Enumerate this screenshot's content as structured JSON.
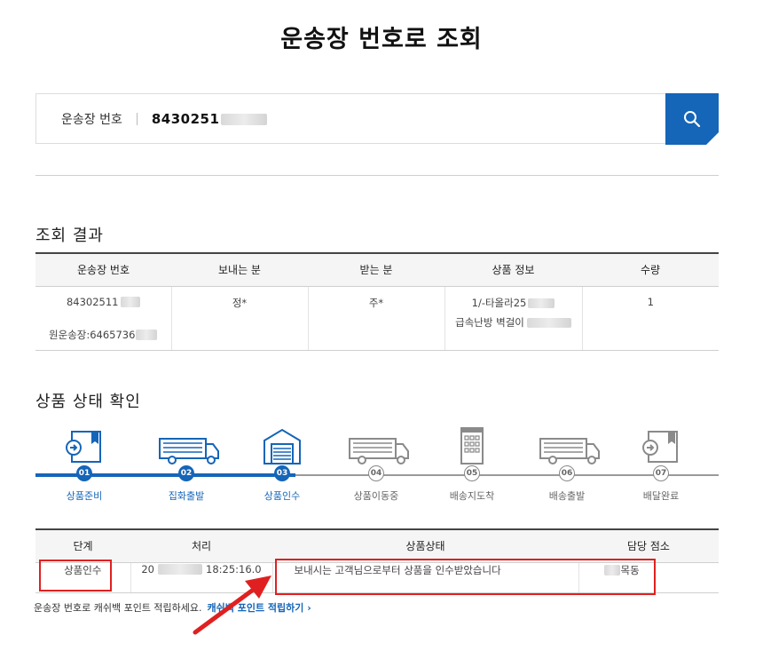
{
  "page": {
    "title": "운송장 번호로 조회"
  },
  "search": {
    "label": "운송장 번호",
    "value_prefix": "8430251",
    "button_icon": "search-icon"
  },
  "result": {
    "section_title": "조회 결과",
    "headers": [
      "운송장 번호",
      "보내는 분",
      "받는 분",
      "상품 정보",
      "수량"
    ],
    "row": {
      "waybill": "84302511",
      "origin_waybill": "원운송장:6465736",
      "sender": "정*",
      "receiver": "주*",
      "product_line1": "1/-타올라25",
      "product_line2": "급속난방 벽걸이",
      "quantity": "1"
    }
  },
  "progress": {
    "section_title": "상품 상태 확인",
    "steps": [
      {
        "num": "01",
        "label": "상품준비",
        "icon": "package-icon",
        "state": "done"
      },
      {
        "num": "02",
        "label": "집화출발",
        "icon": "truck-icon",
        "state": "done"
      },
      {
        "num": "03",
        "label": "상품인수",
        "icon": "warehouse-icon",
        "state": "done"
      },
      {
        "num": "04",
        "label": "상품이동중",
        "icon": "truck-icon",
        "state": "todo"
      },
      {
        "num": "05",
        "label": "배송지도착",
        "icon": "building-icon",
        "state": "todo"
      },
      {
        "num": "06",
        "label": "배송출발",
        "icon": "truck-icon",
        "state": "todo"
      },
      {
        "num": "07",
        "label": "배달완료",
        "icon": "package-icon",
        "state": "todo"
      }
    ],
    "colors": {
      "active": "#1565b8",
      "inactive": "#8a8a8a",
      "highlight": "#e02020"
    }
  },
  "status": {
    "headers": [
      "단계",
      "처리",
      "상품상태",
      "담당 점소"
    ],
    "row": {
      "stage": "상품인수",
      "date_prefix": "20",
      "time": "18:25:16.0",
      "status": "보내시는 고객님으로부터 상품을 인수받았습니다",
      "branch": "목동"
    }
  },
  "footer": {
    "text": "운송장 번호로 캐쉬백 포인트 적립하세요.",
    "link": "캐쉬백 포인트 적립하기 ›"
  }
}
